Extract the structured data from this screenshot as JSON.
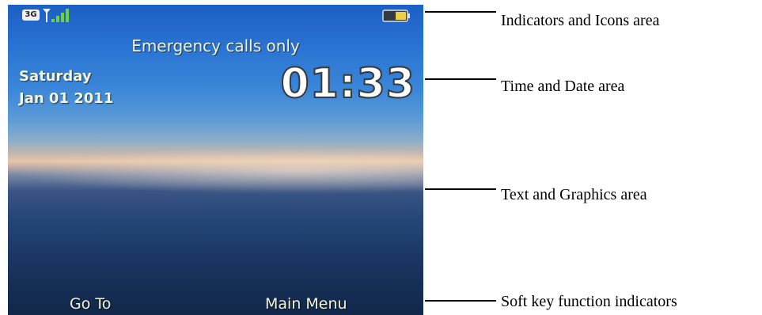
{
  "phone": {
    "network_type": "3G",
    "status_message": "Emergency calls only",
    "day": "Saturday",
    "date": "Jan 01 2011",
    "time": "01:33",
    "softkeys": {
      "left": "Go To",
      "right": "Main Menu"
    }
  },
  "callouts": [
    {
      "label": "Indicators and Icons area"
    },
    {
      "label": "Time and Date area"
    },
    {
      "label": "Text and Graphics area"
    },
    {
      "label": "Soft key function indicators"
    }
  ],
  "colors": {
    "signal_bars": "#6fd23a",
    "battery_fill": "#e8d24a",
    "screen_text": "#f3f4dc"
  }
}
